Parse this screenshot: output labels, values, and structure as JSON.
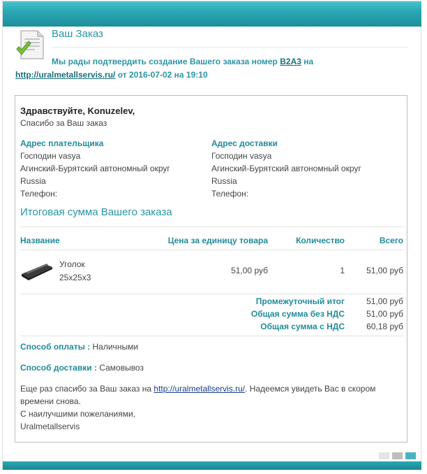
{
  "header": {
    "title": "Ваш Заказ",
    "confirm_prefix": "Мы рады подтвердить создание Вашего заказа номер",
    "order_number": "B2A3",
    "confirm_on": "на",
    "site_link": "http://uralmetallservis.ru/",
    "confirm_from": "от 2016-07-02 на 19:10"
  },
  "greeting": {
    "hello": "Здравствуйте, Konuzelev,",
    "thanks": "Спасибо за Ваш заказ"
  },
  "billing": {
    "title": "Адрес плательщика",
    "name": "Господин vasya",
    "region": "Агинский-Бурятский автономный округ",
    "country": "Russia",
    "phone": "Телефон:"
  },
  "shipping": {
    "title": "Адрес доставки",
    "name": "Господин vasya",
    "region": "Агинский-Бурятский автономный округ",
    "country": "Russia",
    "phone": "Телефон:"
  },
  "summary": {
    "title": "Итоговая сумма Вашего заказа",
    "columns": [
      "Название",
      "Цена за единицу товара",
      "Количество",
      "Всего"
    ],
    "items": [
      {
        "name": "Уголок",
        "variant": "25x25x3",
        "price": "51,00 руб",
        "qty": "1",
        "total": "51,00 руб"
      }
    ],
    "subtotal_label": "Промежуточный итог",
    "subtotal": "51,00 руб",
    "no_vat_label": "Общая сумма без НДС",
    "no_vat": "51,00 руб",
    "vat_label": "Общая сумма с НДС",
    "vat": "60,18 руб"
  },
  "payment": {
    "label": "Способ оплаты :",
    "value": "Наличными"
  },
  "delivery": {
    "label": "Способ доставки :",
    "value": "Самовывоз"
  },
  "footer": {
    "thanks_prefix": "Еще раз спасибо за Ваш заказ на",
    "link": "http://uralmetallservis.ru/",
    "thanks_suffix": ". Надеемся увидеть Вас в скором",
    "line2": "времени снова.",
    "regards": "С наилучшими пожеланиями,",
    "signature": "Uralmetallservis"
  },
  "colors": {
    "accent": "#2b95a5",
    "bar": "#2aa6b4",
    "link": "#1a3e8c"
  },
  "icons": [
    "document-check-icon",
    "steel-angle-product-image"
  ]
}
